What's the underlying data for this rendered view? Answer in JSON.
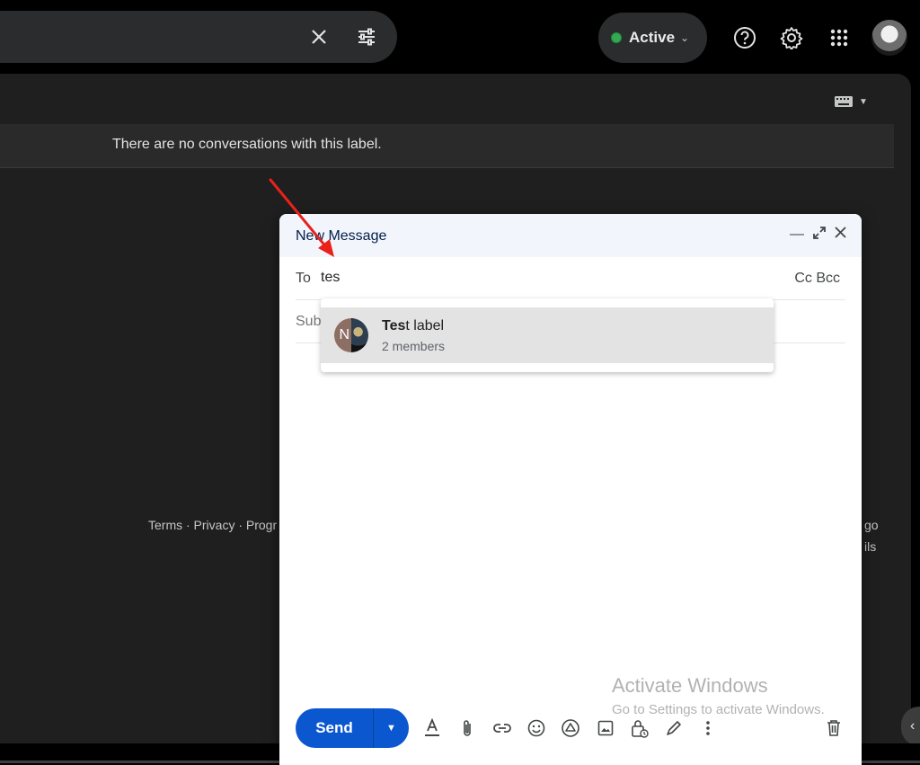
{
  "topbar": {
    "status_label": "Active",
    "status_color": "#34a853"
  },
  "main": {
    "empty_message": "There are no conversations with this label.",
    "footer_left": "Terms · Privacy · Progr",
    "footer_right_1": "go",
    "footer_right_2": "ils"
  },
  "compose": {
    "title": "New Message",
    "to_label": "To",
    "to_value": "tes",
    "cc_bcc": "Cc Bcc",
    "subject_placeholder": "Subject",
    "suggestion": {
      "avatar_initial": "N",
      "name_match": "Tes",
      "name_rest": "t label",
      "subtitle": "2 members"
    },
    "send_label": "Send",
    "accent_color": "#0b57d0"
  },
  "watermark": {
    "line1": "Activate Windows",
    "line2": "Go to Settings to activate Windows."
  },
  "annotation": {
    "arrow_color": "#e8211b"
  }
}
